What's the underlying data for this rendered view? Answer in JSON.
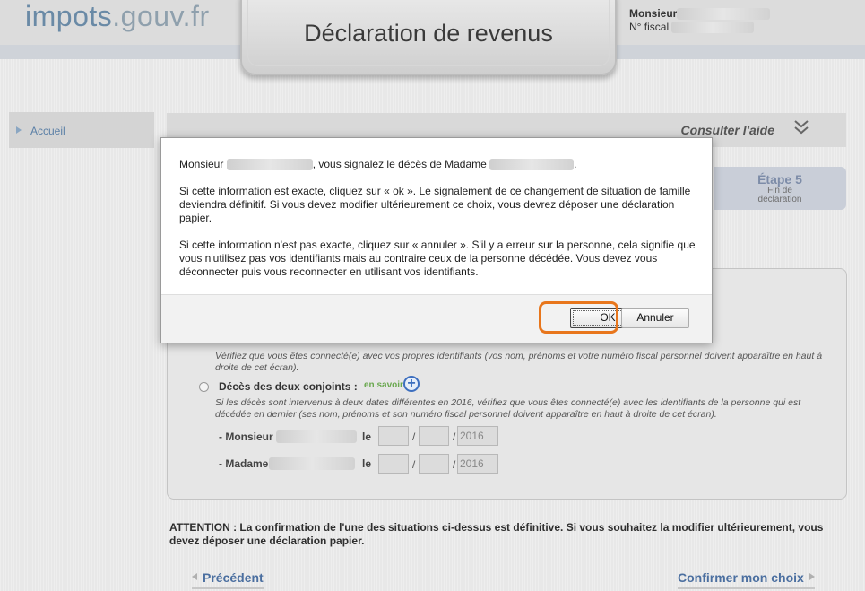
{
  "header": {
    "logo_part1": "impots",
    "logo_part2": ".gouv.fr",
    "title": "Déclaration de revenus",
    "user_label": "Monsieur",
    "fiscal_label": "N° fiscal"
  },
  "sidebar": {
    "items": [
      {
        "label": "Accueil"
      }
    ]
  },
  "help": {
    "label": "Consulter l'aide"
  },
  "step": {
    "title": "Étape 5",
    "line1": "Fin de",
    "line2": "déclaration"
  },
  "form": {
    "note1": "Vérifiez que vous êtes connecté(e) avec vos propres identifiants (vos nom, prénoms et votre numéro fiscal personnel doivent apparaître en haut à droite de cet écran).",
    "option2_label": "Décès des deux conjoints :",
    "en_savoir": "en savoir",
    "note2": "Si les décès sont intervenus à deux dates différentes en 2016, vérifiez que vous êtes connecté(e) avec les identifiants de la personne qui est décédée en dernier (ses nom, prénoms et son numéro fiscal personnel doivent apparaître en haut à droite de cet écran).",
    "monsieur_label": "- Monsieur",
    "madame_label": "- Madame",
    "le_label": "le",
    "slash": "/",
    "year_value": "2016"
  },
  "attention": "ATTENTION : La confirmation de l'une des situations ci-dessus est définitive. Si vous souhaitez la modifier ultérieurement, vous devez déposer une déclaration papier.",
  "nav": {
    "previous": "Précédent",
    "confirm": "Confirmer mon choix"
  },
  "dialog": {
    "line1_prefix": "Monsieur",
    "line1_middle": ", vous signalez le décès de Madame",
    "line1_suffix": ".",
    "para2": "Si cette information est exacte, cliquez sur « ok ». Le signalement de ce changement de situation de famille deviendra définitif. Si vous devez modifier ultérieurement ce choix, vous devrez déposer une déclaration papier.",
    "para3": "Si cette information n'est pas exacte, cliquez sur « annuler ». S'il y a erreur sur la personne, cela signifie que vous n'utilisez pas vos identifiants mais au contraire ceux de la personne décédée. Vous devez vous déconnecter puis vous reconnecter en utilisant vos identifiants.",
    "ok_label": "OK",
    "cancel_label": "Annuler"
  },
  "colors": {
    "highlight": "#e8761c",
    "link": "#4b6fa0",
    "accent_green": "#6aa84f"
  }
}
